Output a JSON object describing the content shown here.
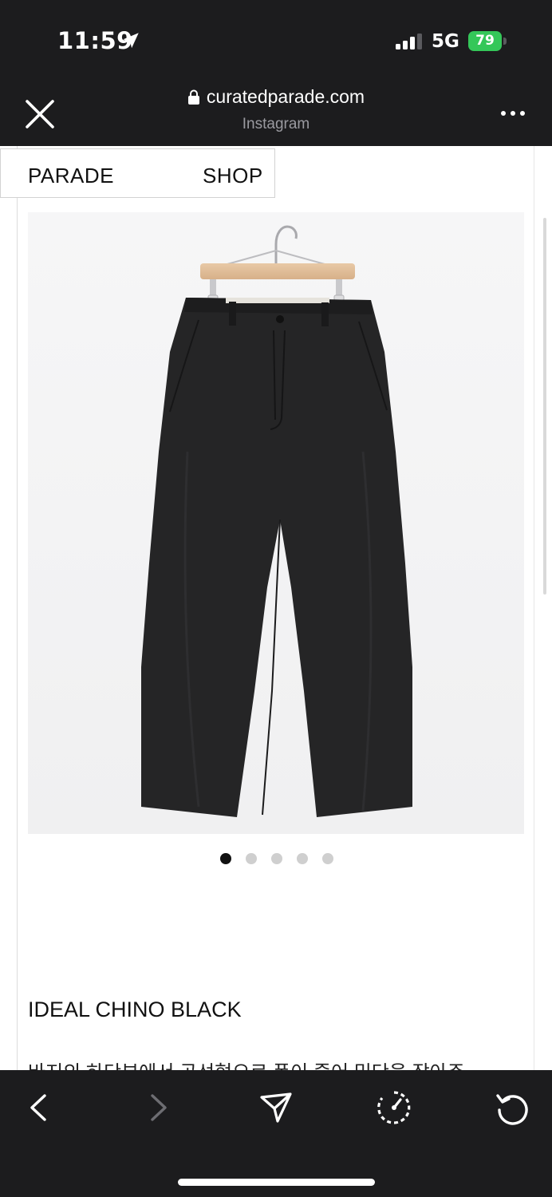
{
  "status_bar": {
    "time": "11:59",
    "network": "5G",
    "battery_level": "79",
    "battery_color": "#34c759"
  },
  "browser": {
    "url": "curatedparade.com",
    "subtitle": "Instagram"
  },
  "site_nav": {
    "left": "PARADE",
    "right": "SHOP"
  },
  "product": {
    "title": "IDEAL CHINO BLACK",
    "description": "바지의 하단부에서 곡선형으로 폼이 줄어 밑단을 잡아주",
    "image": "black chino pants on wooden hanger",
    "carousel": {
      "count": 5,
      "active": 1
    }
  },
  "toolbar": {
    "icons": [
      "back-icon",
      "forward-icon",
      "share-icon",
      "speed-icon",
      "reload-icon"
    ]
  }
}
